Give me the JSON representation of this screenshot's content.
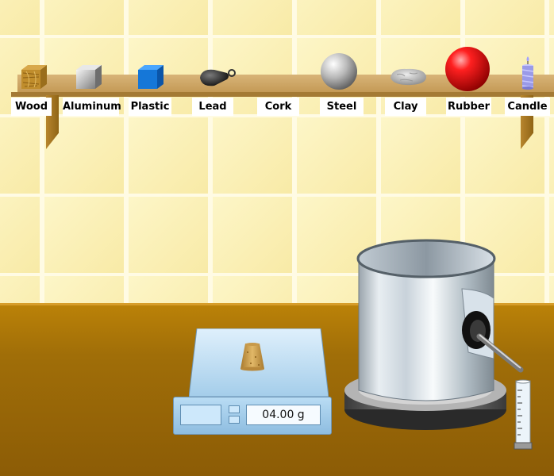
{
  "shelf": {
    "items": [
      {
        "label": "Wood",
        "icon": "wood-cube-icon"
      },
      {
        "label": "Aluminum",
        "icon": "aluminum-cube-icon"
      },
      {
        "label": "Plastic",
        "icon": "plastic-cube-icon"
      },
      {
        "label": "Lead",
        "icon": "lead-weight-icon"
      },
      {
        "label": "Cork",
        "icon": "cork-icon"
      },
      {
        "label": "Steel",
        "icon": "steel-ball-icon"
      },
      {
        "label": "Clay",
        "icon": "clay-lump-icon"
      },
      {
        "label": "Rubber",
        "icon": "rubber-ball-icon"
      },
      {
        "label": "Candle",
        "icon": "candle-icon"
      }
    ]
  },
  "scale": {
    "reading": "04.00 g",
    "object_on_scale": "cork-icon"
  },
  "overflow_can": {
    "icon": "overflow-can-icon"
  },
  "graduated_cylinder": {
    "icon": "graduated-cylinder-icon"
  },
  "colors": {
    "wall": "#fbf0b4",
    "counter": "#a06e08",
    "shelf": "#d2ac6a",
    "scale": "#a8d2f0",
    "rubber": "#e00000",
    "plastic": "#1577d8"
  }
}
